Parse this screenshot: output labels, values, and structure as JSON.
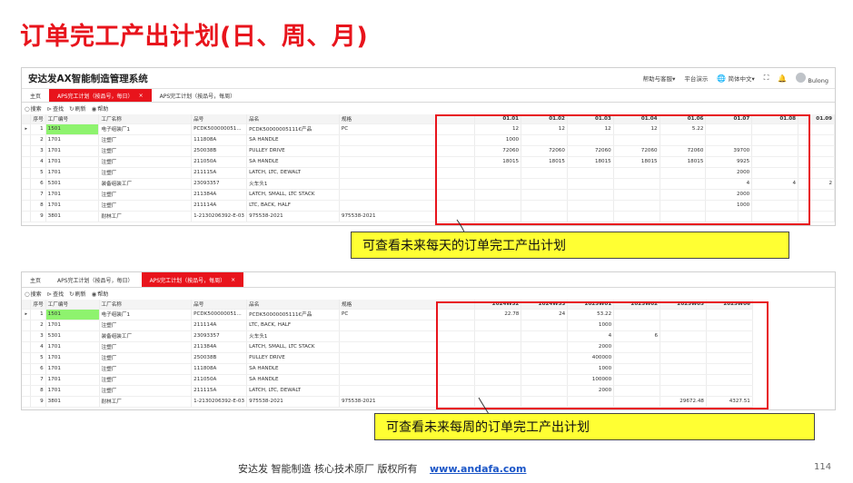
{
  "slide": {
    "title": "订单完工产出计划(日、周、月)",
    "footer_text": "安达发   智能制造 核心技术原厂   版权所有",
    "footer_link": "www.andafa.com",
    "page_number": "114"
  },
  "colors": {
    "accent_red": "#e8141c",
    "highlight_green": "#8ef36e",
    "callout_yellow": "#ffff33"
  },
  "daily": {
    "app_title": "安达发AX智能制造管理系统",
    "header": {
      "help": "帮助与客服▾",
      "platform": "平台演示",
      "language": "简体中文▾",
      "user": "Bulong"
    },
    "tabs": [
      {
        "label": "主页"
      },
      {
        "label": "APS完工计划（按品号，每日）"
      },
      {
        "label": "APS完工计划（按品号，每周）"
      }
    ],
    "toolbar": {
      "search": "搜索",
      "find": "查找",
      "refresh": "刷新",
      "help": "帮助"
    },
    "columns": [
      "序号",
      "工厂编号",
      "工厂名称",
      "品号",
      "品名",
      "规格",
      "01.01",
      "01.02",
      "01.03",
      "01.04",
      "01.06",
      "01.07",
      "01.08",
      "01.09"
    ],
    "rows": [
      [
        "1",
        "1501",
        "电子组装厂1",
        "PCDK500000051...",
        "PCDK50000005111€产品",
        "PC",
        "12",
        "12",
        "12",
        "12",
        "5.22",
        "",
        "",
        ""
      ],
      [
        "2",
        "1701",
        "注塑厂",
        "111808A",
        "SA HANDLE",
        "",
        "1000",
        "",
        "",
        "",
        "",
        "",
        "",
        ""
      ],
      [
        "3",
        "1701",
        "注塑厂",
        "250038B",
        "PULLEY DRIVE",
        "",
        "72060",
        "72060",
        "72060",
        "72060",
        "72060",
        "39700",
        "",
        ""
      ],
      [
        "4",
        "1701",
        "注塑厂",
        "211050A",
        "SA HANDLE",
        "",
        "18015",
        "18015",
        "18015",
        "18015",
        "18015",
        "9925",
        "",
        ""
      ],
      [
        "5",
        "1701",
        "注塑厂",
        "211115A",
        "LATCH, LTC, DEWALT",
        "",
        "",
        "",
        "",
        "",
        "",
        "2000",
        "",
        ""
      ],
      [
        "6",
        "5301",
        "装备组装工厂",
        "23093357",
        "火车头1",
        "",
        "",
        "",
        "",
        "",
        "",
        "4",
        "4",
        "2"
      ],
      [
        "7",
        "1701",
        "注塑厂",
        "211384A",
        "LATCH, SMALL, LTC STACK",
        "",
        "",
        "",
        "",
        "",
        "",
        "2000",
        "",
        ""
      ],
      [
        "8",
        "1701",
        "注塑厂",
        "211114A",
        "LTC, BACK, HALF",
        "",
        "",
        "",
        "",
        "",
        "",
        "1000",
        "",
        ""
      ],
      [
        "9",
        "3801",
        "耐林工厂",
        "1-2130206392-E-03",
        "975538-2021",
        "975538-2021",
        "",
        "",
        "",
        "",
        "",
        "",
        "",
        ""
      ]
    ],
    "callout": "可查看未来每天的订单完工产出计划"
  },
  "weekly": {
    "tabs": [
      {
        "label": "主页"
      },
      {
        "label": "APS完工计划（按品号，每日）"
      },
      {
        "label": "APS完工计划（按品号，每周）"
      }
    ],
    "toolbar": {
      "search": "搜索",
      "find": "查找",
      "refresh": "刷新",
      "help": "帮助"
    },
    "columns": [
      "序号",
      "工厂编号",
      "工厂名称",
      "品号",
      "品名",
      "规格",
      "2024W52",
      "2024W53",
      "2025W01",
      "2025W02",
      "2025W05",
      "2025W06"
    ],
    "rows": [
      [
        "1",
        "1501",
        "电子组装厂1",
        "PCDK500000051...",
        "PCDK50000005111€产品",
        "PC",
        "22.78",
        "24",
        "53.22",
        "",
        "",
        ""
      ],
      [
        "2",
        "1701",
        "注塑厂",
        "211114A",
        "LTC, BACK, HALF",
        "",
        "",
        "",
        "1000",
        "",
        "",
        ""
      ],
      [
        "3",
        "5301",
        "装备组装工厂",
        "23093357",
        "火车头1",
        "",
        "",
        "",
        "4",
        "6",
        "",
        ""
      ],
      [
        "4",
        "1701",
        "注塑厂",
        "211384A",
        "LATCH, SMALL, LTC STACK",
        "",
        "",
        "",
        "2000",
        "",
        "",
        ""
      ],
      [
        "5",
        "1701",
        "注塑厂",
        "250038B",
        "PULLEY DRIVE",
        "",
        "",
        "",
        "400000",
        "",
        "",
        ""
      ],
      [
        "6",
        "1701",
        "注塑厂",
        "111808A",
        "SA HANDLE",
        "",
        "",
        "",
        "1000",
        "",
        "",
        ""
      ],
      [
        "7",
        "1701",
        "注塑厂",
        "211050A",
        "SA HANDLE",
        "",
        "",
        "",
        "100000",
        "",
        "",
        ""
      ],
      [
        "8",
        "1701",
        "注塑厂",
        "211115A",
        "LATCH, LTC, DEWALT",
        "",
        "",
        "",
        "2000",
        "",
        "",
        ""
      ],
      [
        "9",
        "3801",
        "耐林工厂",
        "1-2130206392-E-03",
        "975538-2021",
        "975538-2021",
        "",
        "",
        "",
        "",
        "29672.48",
        "4327.51"
      ]
    ],
    "callout": "可查看未来每周的订单完工产出计划"
  }
}
